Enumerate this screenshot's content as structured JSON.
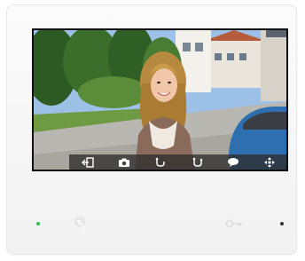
{
  "device": {
    "type": "video-intercom-monitor",
    "led_left_color": "#27c24c",
    "led_right_color": "#333333"
  },
  "screen": {
    "content": "live-camera-feed",
    "toolbar": [
      {
        "icon": "exit-icon"
      },
      {
        "icon": "camera-icon"
      },
      {
        "icon": "unlock-1-icon"
      },
      {
        "icon": "unlock-2-icon"
      },
      {
        "icon": "talk-icon"
      },
      {
        "icon": "navigate-icon"
      }
    ]
  },
  "hardware_buttons": [
    {
      "icon": "call-talk-icon"
    },
    {
      "icon": "key-unlock-icon"
    }
  ]
}
